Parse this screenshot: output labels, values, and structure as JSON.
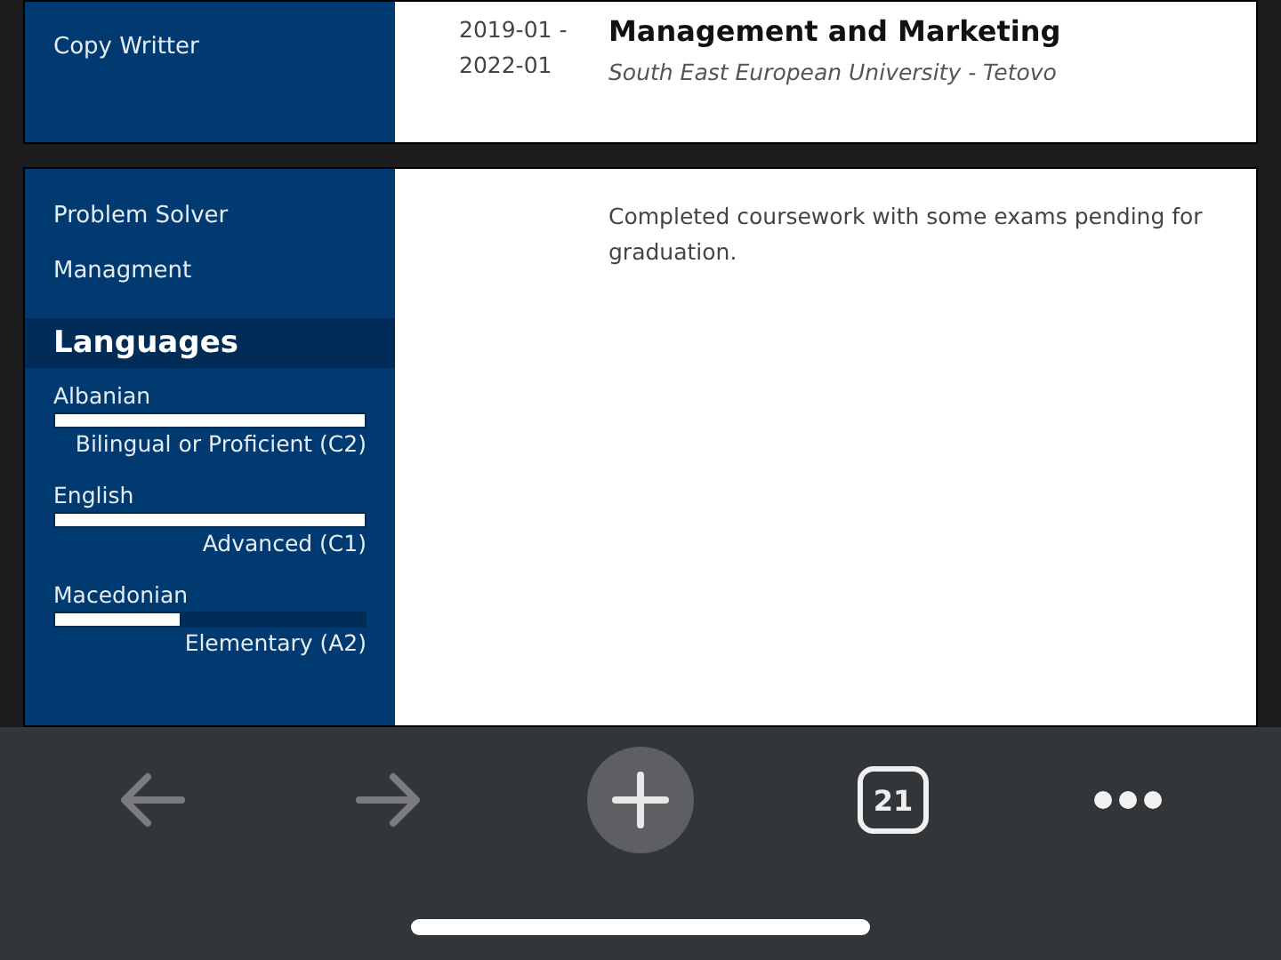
{
  "top_section": {
    "sidebar_items": [
      "Copy Writter"
    ],
    "date": "2019-01 - 2022-01",
    "title": "Management and Marketing",
    "subtitle": "South East European University - Tetovo"
  },
  "bottom_section": {
    "sidebar_items": [
      "Problem Solver",
      "Managment"
    ],
    "languages_heading": "Languages",
    "languages": [
      {
        "name": "Albanian",
        "level": 1,
        "reading": "Bilingual or Proficient (C2)"
      },
      {
        "name": "English",
        "level": 1,
        "reading": "Advanced (C1)"
      },
      {
        "name": "Macedonian",
        "level": 0.4,
        "reading": "Elementary (A2)"
      }
    ],
    "description": "Completed coursework with some exams pending for graduation."
  },
  "toolbar": {
    "tab_count": "21"
  }
}
